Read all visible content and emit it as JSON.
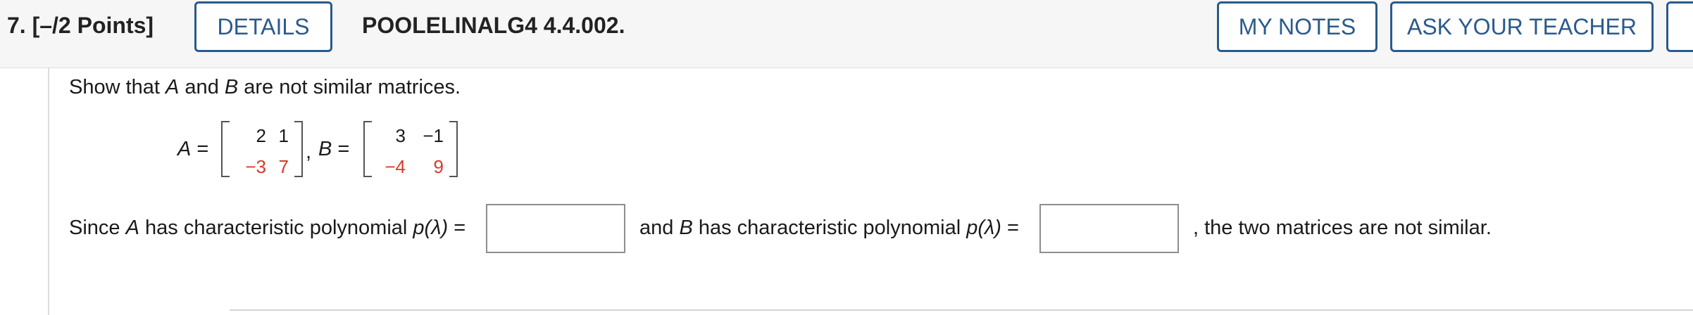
{
  "header": {
    "question_number": "7.",
    "points": "[–/2 Points]",
    "details_label": "DETAILS",
    "problem_id": "POOLELINALG4 4.4.002.",
    "my_notes_label": "MY NOTES",
    "ask_teacher_label": "ASK YOUR TEACHER"
  },
  "problem": {
    "prompt_pre": "Show that ",
    "prompt_a": "A",
    "prompt_mid": " and ",
    "prompt_b": "B",
    "prompt_post": " are not similar matrices.",
    "matrix_a_label": "A",
    "matrix_b_label": "B",
    "equals": "=",
    "separator": ",",
    "matrix_a": [
      [
        "2",
        "1"
      ],
      [
        "−3",
        "7"
      ]
    ],
    "matrix_b": [
      [
        "3",
        "−1"
      ],
      [
        "−4",
        "9"
      ]
    ],
    "line_since": "Since ",
    "line_a": "A",
    "line_has": " has characteristic polynomial ",
    "poly": "p(λ)",
    "line_and": "and ",
    "line_b": "B",
    "line_end": ", the two matrices are not similar."
  },
  "answers": {
    "char_poly_a": "",
    "char_poly_b": ""
  },
  "colors": {
    "accent": "#2a5a8c",
    "highlight": "#d63a2a"
  }
}
